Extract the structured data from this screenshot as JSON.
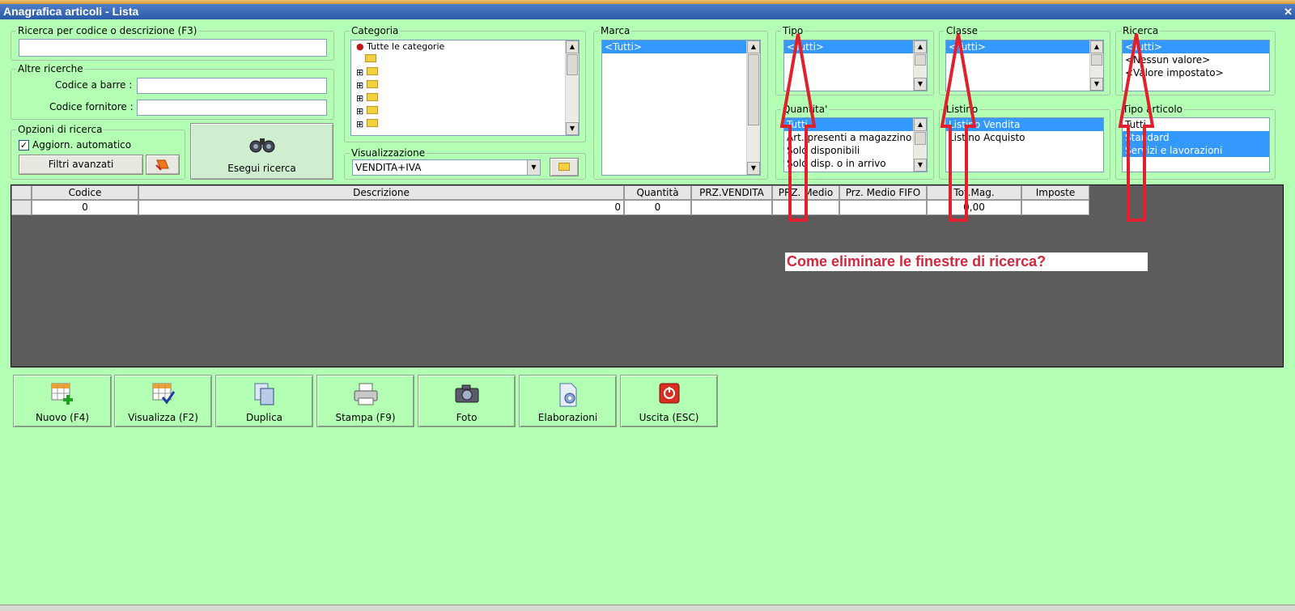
{
  "window": {
    "title": "Anagrafica articoli  - Lista",
    "close": "✕"
  },
  "search": {
    "legend": "Ricerca per codice o descrizione (F3)",
    "value": ""
  },
  "other_search": {
    "legend": "Altre ricerche",
    "barcode_label": "Codice a barre :",
    "barcode_value": "",
    "supplier_label": "Codice fornitore :",
    "supplier_value": ""
  },
  "options": {
    "legend": "Opzioni di ricerca",
    "auto_update_label": "Aggiorn. automatico",
    "auto_update_checked": true,
    "advanced_filters": "Filtri avanzati"
  },
  "run_search": {
    "label": "Esegui ricerca"
  },
  "categoria": {
    "legend": "Categoria",
    "root": "Tutte le categorie"
  },
  "visualizzazione": {
    "legend": "Visualizzazione",
    "selected": "VENDITA+IVA"
  },
  "marca": {
    "legend": "Marca",
    "items": [
      "<Tutti>"
    ]
  },
  "tipo": {
    "legend": "Tipo",
    "items": [
      "<Tutti>"
    ]
  },
  "classe": {
    "legend": "Classe",
    "items": [
      "<Tutti>"
    ]
  },
  "ricerca": {
    "legend": "Ricerca",
    "items": [
      "<Tutti>",
      "<Nessun valore>",
      "<Valore impostato>"
    ]
  },
  "quantita": {
    "legend": "Quantita'",
    "items": [
      "Tutti",
      "Art. presenti a magazzino",
      "Solo disponibili",
      "Solo disp. o in arrivo"
    ]
  },
  "listino": {
    "legend": "Listino",
    "items": [
      "Listino Vendita",
      "Listino Acquisto"
    ]
  },
  "tipo_articolo": {
    "legend": "Tipo articolo",
    "items": [
      "Tutti",
      "Standard",
      "Servizi e lavorazioni"
    ]
  },
  "table": {
    "columns": [
      "Codice",
      "Descrizione",
      "Quantità",
      "PRZ.VENDITA",
      "PRZ. Medio",
      "Prz. Medio FIFO",
      "Tot.Mag.",
      "Imposte"
    ],
    "row": [
      "0",
      "0",
      "0",
      "",
      "",
      "",
      "0,00",
      ""
    ]
  },
  "annotation": "Come eliminare le finestre di ricerca?",
  "toolbar": {
    "new": "Nuovo (F4)",
    "view": "Visualizza (F2)",
    "duplicate": "Duplica",
    "print": "Stampa (F9)",
    "photo": "Foto",
    "processing": "Elaborazioni",
    "exit": "Uscita (ESC)"
  },
  "colors": {
    "background": "#b3ffb3",
    "selection": "#3399ff",
    "arrow": "#e0202c",
    "grid": "#5c5c5c"
  }
}
